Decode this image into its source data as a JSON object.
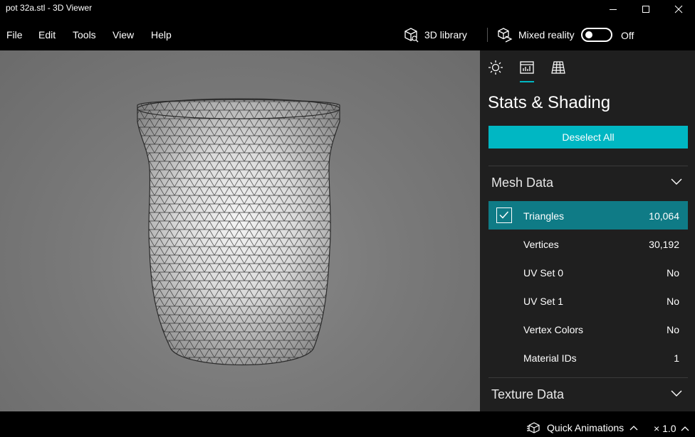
{
  "window": {
    "title": "pot 32a.stl - 3D Viewer"
  },
  "menu": {
    "items": [
      "File",
      "Edit",
      "Tools",
      "View",
      "Help"
    ],
    "library_label": "3D library",
    "mixed_reality_label": "Mixed reality",
    "toggle_state": "Off"
  },
  "panel": {
    "tabs": [
      "lighting-icon",
      "stats-icon",
      "grid-icon"
    ],
    "title": "Stats & Shading",
    "deselect_label": "Deselect All",
    "mesh_section": "Mesh Data",
    "rows": [
      {
        "label": "Triangles",
        "value": "10,064"
      },
      {
        "label": "Vertices",
        "value": "30,192"
      },
      {
        "label": "UV Set 0",
        "value": "No"
      },
      {
        "label": "UV Set 1",
        "value": "No"
      },
      {
        "label": "Vertex Colors",
        "value": "No"
      },
      {
        "label": "Material IDs",
        "value": "1"
      }
    ],
    "texture_section": "Texture Data"
  },
  "bottom": {
    "quick_animations_label": "Quick Animations",
    "speed": "× 1.0"
  },
  "colors": {
    "accent": "#00b7c3",
    "selected_row": "#0f7b86",
    "panel_bg": "#1f1f1f",
    "viewport_bg": "#7a7a7a"
  }
}
